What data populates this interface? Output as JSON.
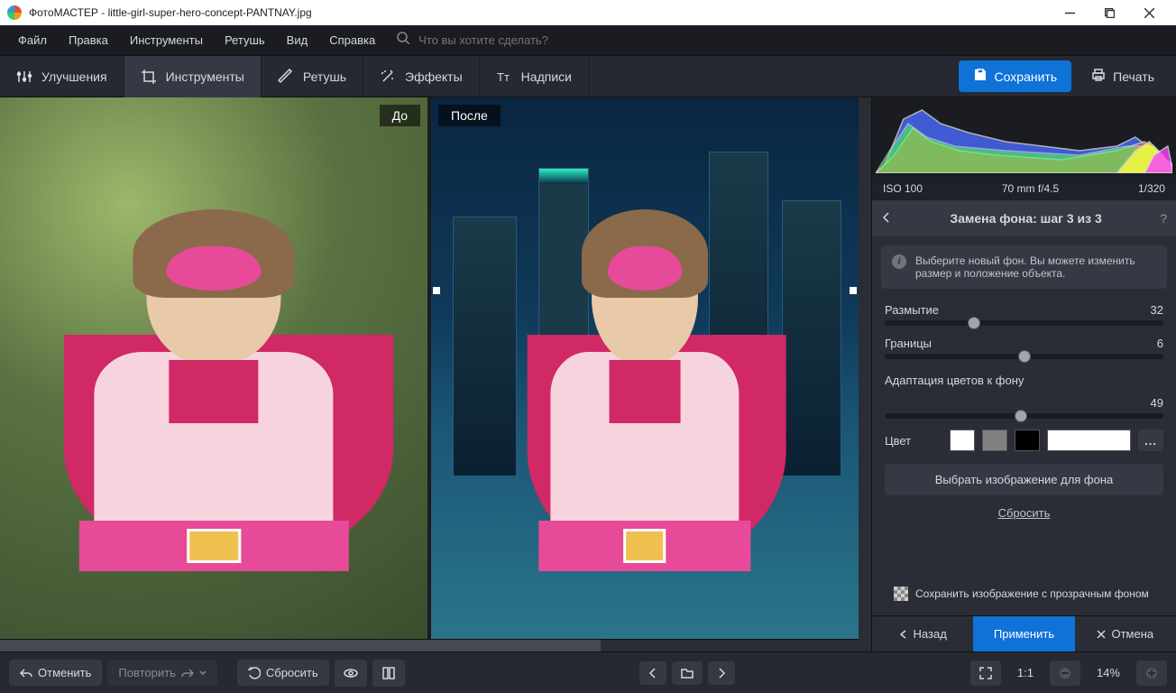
{
  "titlebar": {
    "app": "ФотоМАСТЕР",
    "file": "little-girl-super-hero-concept-PANTNAY.jpg"
  },
  "menubar": {
    "items": [
      "Файл",
      "Правка",
      "Инструменты",
      "Ретушь",
      "Вид",
      "Справка"
    ],
    "search_placeholder": "Что вы хотите сделать?"
  },
  "toolbar": {
    "tabs": [
      {
        "label": "Улучшения",
        "icon": "sliders"
      },
      {
        "label": "Инструменты",
        "icon": "crop",
        "active": true
      },
      {
        "label": "Ретушь",
        "icon": "brush"
      },
      {
        "label": "Эффекты",
        "icon": "wand"
      },
      {
        "label": "Надписи",
        "icon": "text"
      }
    ],
    "save": "Сохранить",
    "print": "Печать"
  },
  "canvas": {
    "before": "До",
    "after": "После"
  },
  "histogram": {
    "iso": "ISO 100",
    "lens": "70 mm f/4.5",
    "shutter": "1/320"
  },
  "panel": {
    "title": "Замена фона: шаг 3 из 3",
    "info": "Выберите новый фон. Вы можете изменить размер и положение объекта.",
    "sliders": {
      "blur": {
        "label": "Размытие",
        "value": 32,
        "pos": 32
      },
      "edges": {
        "label": "Границы",
        "value": 6,
        "pos": 50
      }
    },
    "adapt_label": "Адаптация цветов к фону",
    "adapt": {
      "value": 49,
      "pos": 49
    },
    "color_label": "Цвет",
    "choose_bg": "Выбрать изображение для фона",
    "reset": "Сбросить",
    "save_transparent": "Сохранить изображение с прозрачным фоном",
    "actions": {
      "back": "Назад",
      "apply": "Применить",
      "cancel": "Отмена"
    }
  },
  "bottombar": {
    "undo": "Отменить",
    "redo": "Повторить",
    "reset": "Сбросить",
    "zoom": "14%",
    "ratio": "1:1"
  }
}
